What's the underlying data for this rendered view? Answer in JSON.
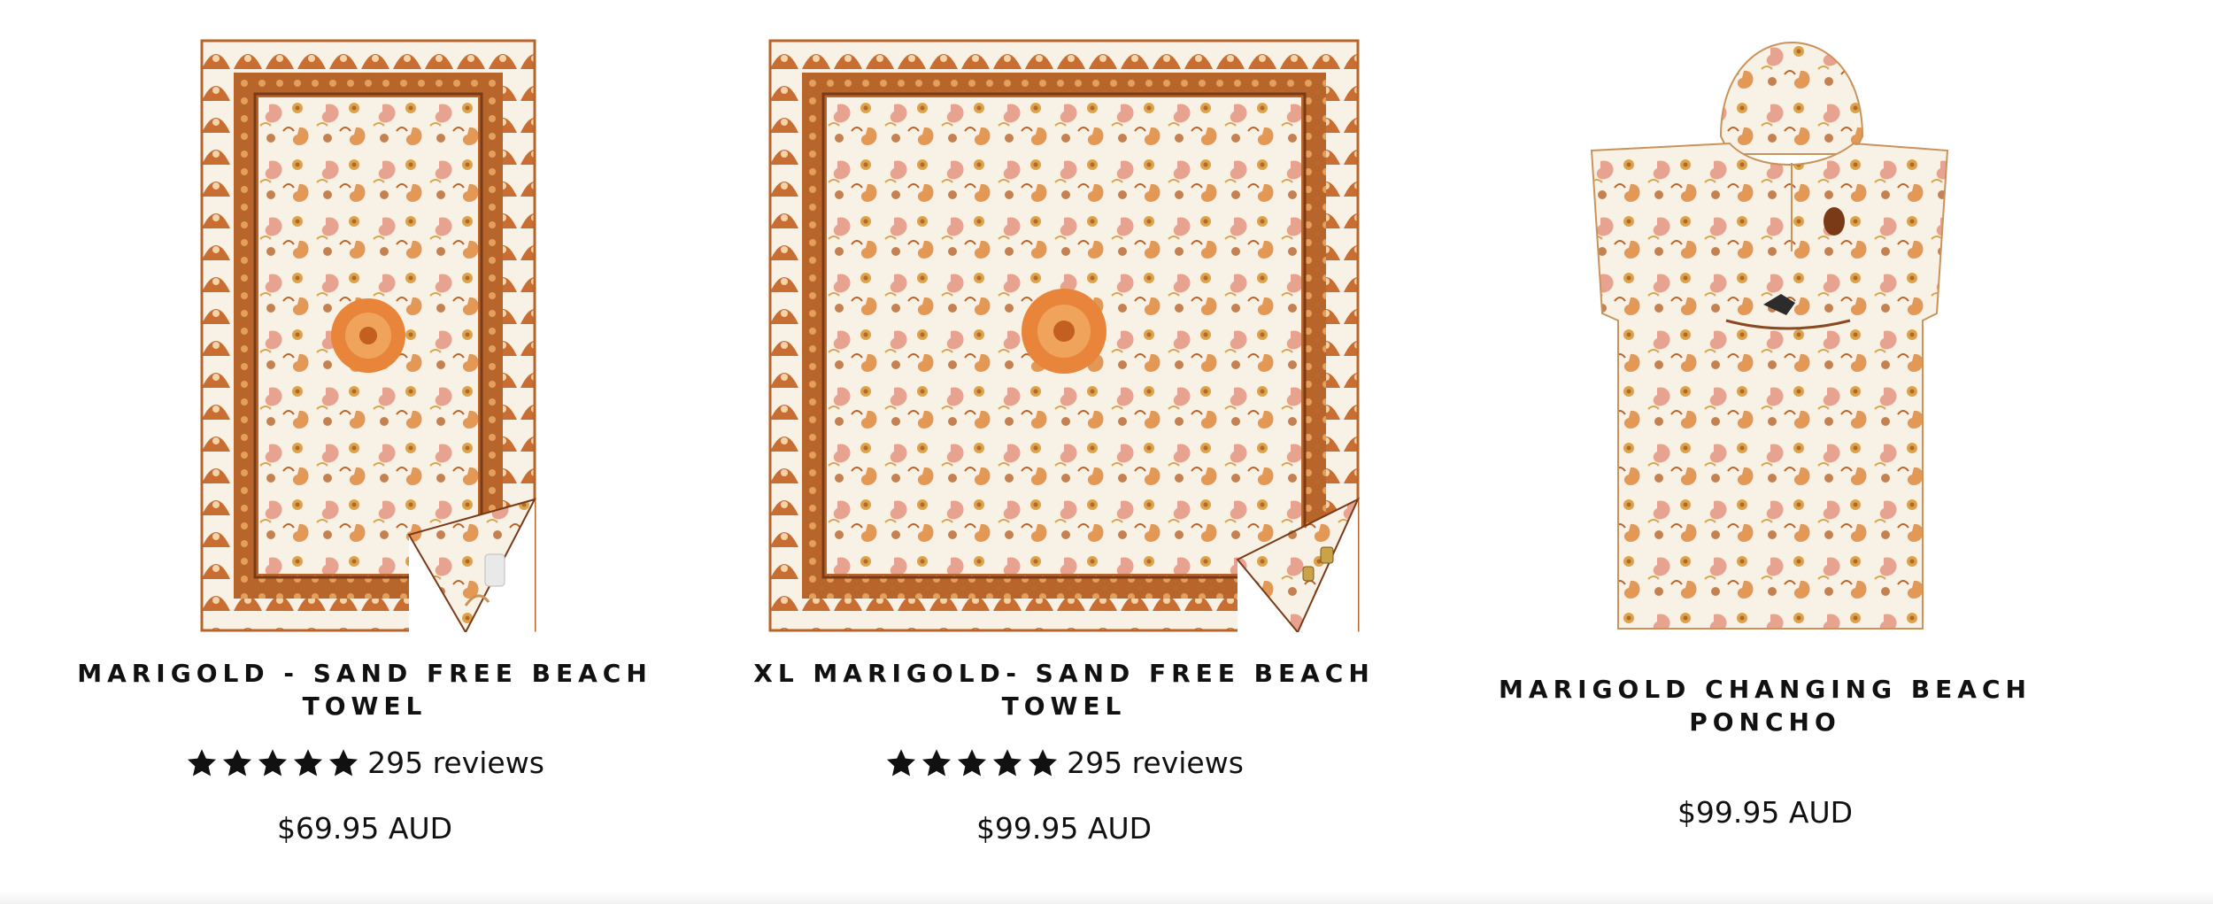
{
  "colors": {
    "rust": "#b8652c",
    "orange": "#e08a3c",
    "cream": "#f8f1e6",
    "pink": "#e79a86",
    "gold": "#d9a44a",
    "text": "#111111"
  },
  "products": [
    {
      "title_line1": "MARIGOLD - SAND FREE BEACH",
      "title_line2": "TOWEL",
      "rating_stars": 5,
      "reviews": "295 reviews",
      "price": "$69.95 AUD",
      "image_icon": "beach-towel-image"
    },
    {
      "title_line1": "XL MARIGOLD- SAND FREE BEACH",
      "title_line2": "TOWEL",
      "rating_stars": 5,
      "reviews": "295 reviews",
      "price": "$99.95 AUD",
      "image_icon": "xl-beach-towel-image"
    },
    {
      "title_line1": "MARIGOLD CHANGING BEACH",
      "title_line2": "PONCHO",
      "price": "$99.95 AUD",
      "image_icon": "poncho-image"
    }
  ]
}
